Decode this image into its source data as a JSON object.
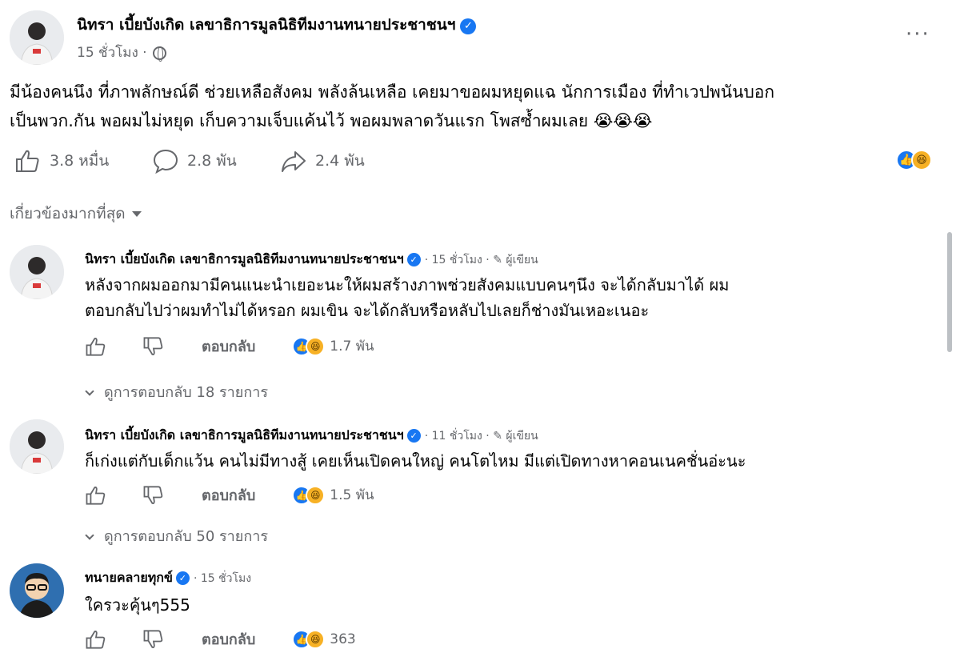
{
  "post": {
    "author": "นิทรา เบี้ยบังเกิด เลขาธิการมูลนิธิทีมงานทนายประชาชนฯ",
    "time": "15 ชั่วโมง ·",
    "more_label": "···",
    "text_line1": "มีน้องคนนึง ที่ภาพลักษณ์ดี ช่วยเหลือสังคม พลังล้นเหลือ เคยมาขอผมหยุดแฉ นักการเมือง ที่ทำเวปพนันบอก",
    "text_line2": "เป็นพวก.กัน พอผมไม่หยุด เก็บความเจ็บแค้นไว้ พอผมพลาดวันแรก โพสซ้ำผมเลย",
    "emoji_tail": "😭😭😭",
    "likes": "3.8 หมื่น",
    "comments": "2.8 พัน",
    "shares": "2.4 พัน"
  },
  "sort": {
    "label": "เกี่ยวข้องมากที่สุด"
  },
  "comments": [
    {
      "author": "นิทรา เบี้ยบังเกิด เลขาธิการมูลนิธิทีมงานทนายประชาชนฯ",
      "meta": "· 15 ชั่วโมง · ✎ ผู้เขียน",
      "line1": "หลังจากผมออกมามีคนแนะนำเยอะนะให้ผมสร้างภาพช่วยสังคมแบบคนๆนึง จะได้กลับมาได้ ผม",
      "line2": "ตอบกลับไปว่าผมทำไม่ได้หรอก ผมเขิน จะได้กลับหรือหลับไปเลยก็ช่างมันเหอะเนอะ",
      "reply_label": "ตอบกลับ",
      "reactions": "1.7 พัน",
      "view_replies": "ดูการตอบกลับ 18 รายการ"
    },
    {
      "author": "นิทรา เบี้ยบังเกิด เลขาธิการมูลนิธิทีมงานทนายประชาชนฯ",
      "meta": "· 11 ชั่วโมง · ✎ ผู้เขียน",
      "line1": "ก็เก่งแต่กับเด็กแว้น คนไม่มีทางสู้ เคยเห็นเปิดคนใหญ่ คนโตไหม มีแต่เปิดทางหาคอนเนคชั่นอ่ะนะ",
      "reply_label": "ตอบกลับ",
      "reactions": "1.5 พัน",
      "view_replies": "ดูการตอบกลับ 50 รายการ"
    },
    {
      "author": "ทนายคลายทุกข์",
      "meta": "· 15 ชั่วโมง",
      "line1": "ใครวะคุ้นๆ555",
      "reply_label": "ตอบกลับ",
      "reactions": "363"
    }
  ],
  "colors": {
    "accent": "#1877f2",
    "secondary_text": "#65676b",
    "primary_text": "#050505"
  },
  "icons": [
    "like-icon",
    "comment-icon",
    "share-icon",
    "globe-icon",
    "verified-icon",
    "dislike-icon",
    "chevron-down-icon"
  ]
}
